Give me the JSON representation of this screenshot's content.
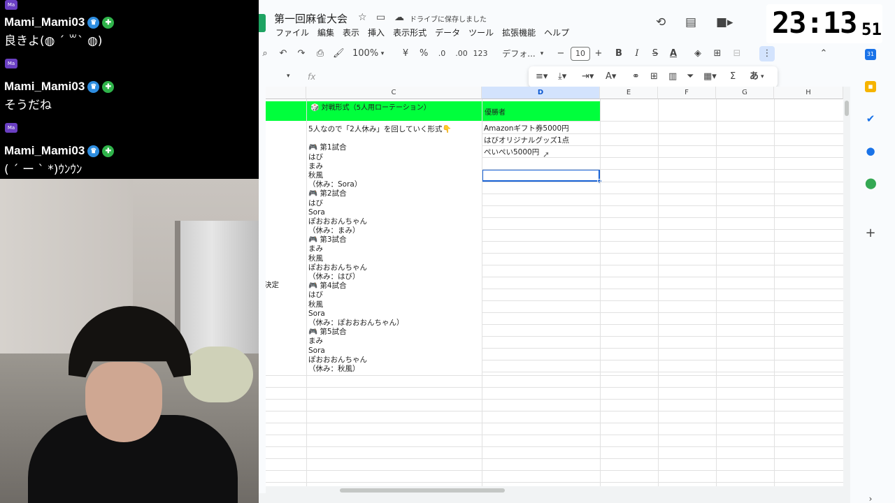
{
  "chat": {
    "messages": [
      {
        "user": "Mami_Mami03",
        "text": "良きよ(◍ ´ ꒳` ◍)"
      },
      {
        "user": "Mami_Mami03",
        "text": "そうだね"
      },
      {
        "user": "Mami_Mami03",
        "text": "( ´ ー ` *)ｳﾝｳﾝ"
      }
    ],
    "avatar_label": "Ma"
  },
  "clock": {
    "hours_minutes": "23:13",
    "seconds": "51"
  },
  "sheet": {
    "title": "第一回麻雀大会",
    "saved_status": "ドライブに保存しました",
    "menu": [
      "ファイル",
      "編集",
      "表示",
      "挿入",
      "表示形式",
      "データ",
      "ツール",
      "拡張機能",
      "ヘルプ"
    ],
    "toolbar": {
      "zoom": "100%",
      "currency": "¥",
      "percent": "%",
      "decrease_decimal": ".0",
      "increase_decimal": ".00",
      "number_format": "123",
      "font": "デフォ...",
      "font_size": "10",
      "bold": "B",
      "italic": "I",
      "strike": "S",
      "text_color": "A",
      "sigma": "Σ",
      "ime": "あ"
    },
    "fx": "fx",
    "columns": [
      "C",
      "D",
      "E",
      "F",
      "G",
      "H"
    ],
    "header_c": "🎲 対戦形式（5人用ローテーション）",
    "header_d": "優勝者",
    "column_c_lines": [
      "5人なので「2人休み」を回していく形式👇",
      "",
      "🎮 第1試合",
      "はび",
      "まみ",
      "秋風",
      "（休み：Sora）",
      "🎮 第2試合",
      "はび",
      "Sora",
      "ぽおおおんちゃん",
      "（休み：まみ）",
      "🎮 第3試合",
      "まみ",
      "秋風",
      "ぽおおおんちゃん",
      "（休み：はび）",
      "🎮 第4試合",
      "はび",
      "秋風",
      "Sora",
      "（休み：ぽおおおんちゃん）",
      "🎮 第5試合",
      "まみ",
      "Sora",
      "ぽおおおんちゃん",
      "（休み：秋風）"
    ],
    "column_d_lines": [
      "Amazonギフト券5000円",
      "はびオリジナルグッズ1点",
      "ぺいぺい5000円"
    ],
    "column_b_partial": "決定"
  },
  "icons": {
    "star": "star-icon",
    "folder": "folder-icon",
    "cloud": "cloud-icon",
    "history": "history-icon",
    "comment": "comment-icon",
    "meet": "video-icon"
  },
  "colors": {
    "header_green": "#00ff3c",
    "selection": "#1a63d6",
    "chat_bg": "#000000"
  }
}
